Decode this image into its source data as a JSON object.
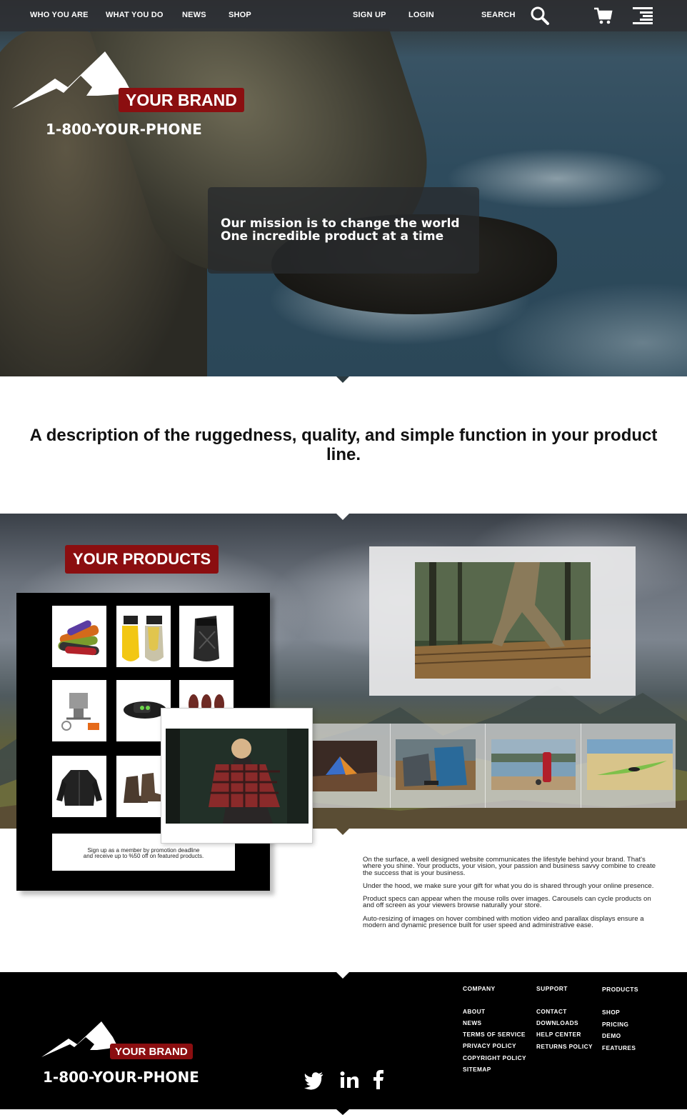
{
  "nav": {
    "links": [
      "WHO YOU ARE",
      "WHAT YOU DO",
      "NEWS",
      "SHOP"
    ],
    "signup": "SIGN UP",
    "login": "LOGIN",
    "search_label": "SEARCH"
  },
  "icons": [
    "search-icon",
    "cart-icon",
    "menu-icon",
    "twitter-icon",
    "linkedin-icon",
    "facebook-icon"
  ],
  "brand": {
    "name": "YOUR BRAND",
    "phone": "1-800-YOUR-PHONE",
    "accent_color": "#8b0e10"
  },
  "hero": {
    "mission_line1": "Our mission is to change the world",
    "mission_line2": "One incredible product at a time"
  },
  "description": "A description of the ruggedness, quality, and simple function in your product line.",
  "products": {
    "title": "YOUR PRODUCTS",
    "catalog_items": [
      "straps",
      "dry bags",
      "backpack",
      "camp stove",
      "headlamp",
      "snowshoes",
      "jacket",
      "boots"
    ],
    "promo_line1": "Sign up as a member by promotion deadline",
    "promo_line2": "and receive up to %50 off on featured products.",
    "carousel_items": [
      "tent",
      "backpacks",
      "thermos",
      "kayak"
    ]
  },
  "copy": {
    "p1": "On the surface, a well designed website communicates the lifestyle behind your brand. That's where you shine. Your products, your vision, your passion and business savvy combine to create the success that is your business.",
    "p2": "Under the hood, we make sure your gift for what you do is shared through your online presence.",
    "p3": "Product specs can appear when the mouse rolls over images. Carousels can cycle products on and off screen as your viewers browse naturally your store.",
    "p4": "Auto-resizing of images on hover combined with motion video and parallax displays ensure a modern and dynamic presence built for user speed and administrative ease."
  },
  "footer": {
    "company": {
      "heading": "COMPANY",
      "links": [
        "ABOUT",
        "NEWS",
        "TERMS OF SERVICE",
        "PRIVACY POLICY",
        "COPYRIGHT POLICY",
        "SITEMAP"
      ]
    },
    "support": {
      "heading": "SUPPORT",
      "links": [
        "CONTACT",
        "DOWNLOADS",
        "HELP CENTER",
        "RETURNS POLICY"
      ]
    },
    "products": {
      "heading": "PRODUCTS",
      "links": [
        "SHOP",
        "PRICING",
        "DEMO",
        "FEATURES"
      ]
    }
  }
}
